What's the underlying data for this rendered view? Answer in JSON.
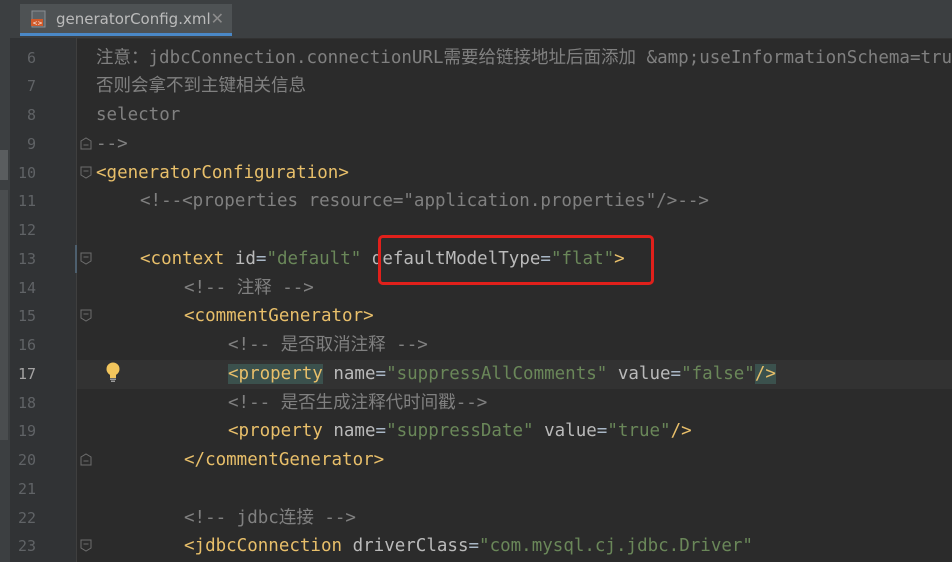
{
  "tab": {
    "filename": "generatorConfig.xml",
    "close": "✕"
  },
  "gutter": {
    "line_numbers": [
      "6",
      "7",
      "8",
      "9",
      "10",
      "11",
      "12",
      "13",
      "14",
      "15",
      "16",
      "17",
      "18",
      "19",
      "20",
      "21",
      "22",
      "23"
    ],
    "current_line": "17"
  },
  "code": {
    "l6": {
      "a": "注意：",
      "b": "jdbcConnection.connectionURL",
      "c": "需要给链接地址后面添加",
      "d": " &amp;useInformationSchema=true"
    },
    "l7": {
      "a": "否则会拿不到主键相关信息"
    },
    "l8": {
      "a": "selector"
    },
    "l9": {
      "a": "-->"
    },
    "l10": {
      "a": "<generatorConfiguration>"
    },
    "l11": {
      "a": "<!--<properties resource=\"application.properties\"/>-->"
    },
    "l13": {
      "tag": "<context",
      "a1": " id",
      "eq1": "=",
      "v1": "\"default\"",
      "a2": " defaultModelType",
      "eq2": "=",
      "v2": "\"flat\"",
      "close": ">"
    },
    "l14": {
      "a": "<!-- ",
      "b": "注释",
      "c": " -->"
    },
    "l15": {
      "a": "<commentGenerator>"
    },
    "l16": {
      "a": "<!-- ",
      "b": "是否取消注释",
      "c": " -->"
    },
    "l17": {
      "tag": "<property",
      "a1": " name",
      "eq1": "=",
      "v1": "\"suppressAllComments\"",
      "a2": " value",
      "eq2": "=",
      "v2": "\"false\"",
      "close": "/>"
    },
    "l18": {
      "a": "<!-- ",
      "b": "是否生成注释代时间戳",
      "c": "-->"
    },
    "l19": {
      "tag": "<property",
      "a1": " name",
      "eq1": "=",
      "v1": "\"suppressDate\"",
      "a2": " value",
      "eq2": "=",
      "v2": "\"true\"",
      "close": "/>"
    },
    "l20": {
      "a": "</commentGenerator>"
    },
    "l22": {
      "a": "<!-- jdbc",
      "b": "连接",
      "c": " -->"
    },
    "l23": {
      "tag": "<jdbcConnection",
      "a1": " driverClass",
      "eq1": "=",
      "v1": "\"com.mysql.cj.jdbc.Driver\""
    }
  },
  "colors": {
    "background": "#2b2b2b",
    "tag": "#e8bf6a",
    "string": "#6a8759",
    "comment": "#808080",
    "highlight_box": "#e0201b"
  },
  "icons": {
    "file_icon": "xml-file-icon",
    "bulb": "lightbulb-icon",
    "fold": "fold-marker-icon"
  }
}
